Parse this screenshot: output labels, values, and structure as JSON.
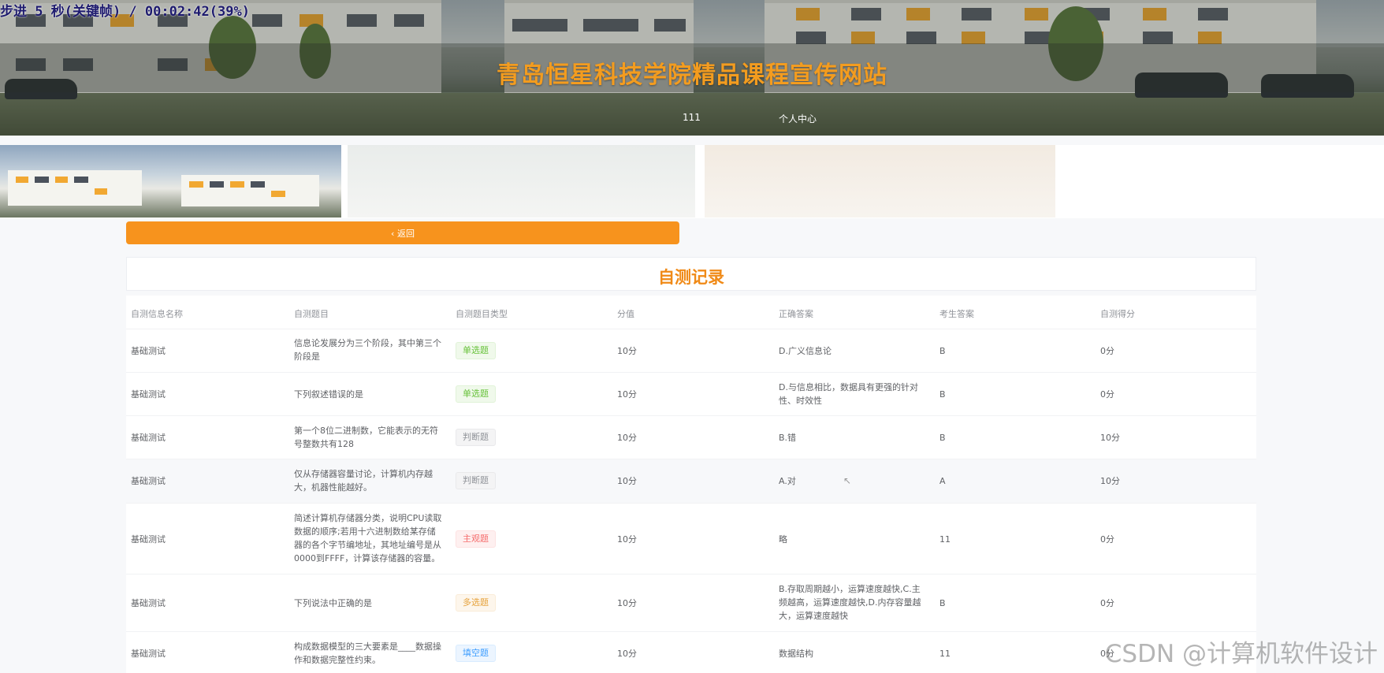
{
  "overlay_text": "步进 5 秒(关键帧) / 00:02:42(39%)",
  "header": {
    "title": "青岛恒星科技学院精品课程宣传网站",
    "nav": [
      "111",
      "个人中心"
    ]
  },
  "back_button": {
    "label": "‹ 返回"
  },
  "section": {
    "title": "自测记录"
  },
  "table": {
    "columns": [
      "自测信息名称",
      "自测题目",
      "自测题目类型",
      "分值",
      "正确答案",
      "考生答案",
      "自测得分"
    ],
    "rows": [
      {
        "name": "基础测试",
        "question": "信息论发展分为三个阶段，其中第三个阶段是",
        "type": "单选题",
        "type_color": "green",
        "score": "10分",
        "answer": "D.广义信息论",
        "user_answer": "B",
        "got": "0分"
      },
      {
        "name": "基础测试",
        "question": "下列叙述错误的是",
        "type": "单选题",
        "type_color": "green",
        "score": "10分",
        "answer": "D.与信息相比，数据具有更强的针对性、时效性",
        "user_answer": "B",
        "got": "0分"
      },
      {
        "name": "基础测试",
        "question": "第一个8位二进制数，它能表示的无符号整数共有128",
        "type": "判断题",
        "type_color": "gray",
        "score": "10分",
        "answer": "B.错",
        "user_answer": "B",
        "got": "10分"
      },
      {
        "name": "基础测试",
        "question": "仅从存储器容量讨论，计算机内存越大，机器性能越好。",
        "type": "判断题",
        "type_color": "gray",
        "score": "10分",
        "answer": "A.对",
        "user_answer": "A",
        "got": "10分"
      },
      {
        "name": "基础测试",
        "question": "简述计算机存储器分类，说明CPU读取数据的顺序;若用十六进制数给某存储器的各个字节编地址，其地址编号是从0000到FFFF，计算该存储器的容量。",
        "type": "主观题",
        "type_color": "red",
        "score": "10分",
        "answer": "略",
        "user_answer": "11",
        "got": "0分"
      },
      {
        "name": "基础测试",
        "question": "下列说法中正确的是",
        "type": "多选题",
        "type_color": "orange",
        "score": "10分",
        "answer": "B.存取周期越小，运算速度越快,C.主频越高，运算速度越快,D.内存容量越大，运算速度越快",
        "user_answer": "B",
        "got": "0分"
      },
      {
        "name": "基础测试",
        "question": "构成数据模型的三大要素是____数据操作和数据完整性约束。",
        "type": "填空题",
        "type_color": "blue",
        "score": "10分",
        "answer": "数据结构",
        "user_answer": "11",
        "got": "0分"
      }
    ]
  },
  "watermark": "CSDN @计算机软件设计"
}
